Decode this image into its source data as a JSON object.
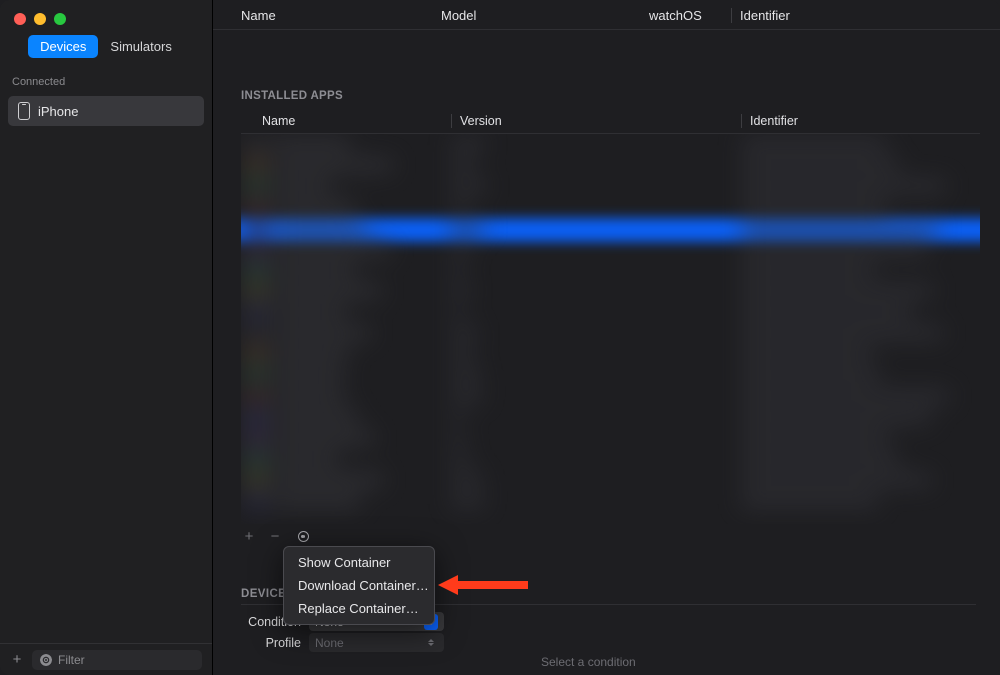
{
  "sidebar": {
    "tabs": {
      "devices": "Devices",
      "simulators": "Simulators"
    },
    "connected_label": "Connected",
    "device_name": "iPhone",
    "filter_placeholder": "Filter"
  },
  "watches_header": {
    "name": "Name",
    "model": "Model",
    "watchos": "watchOS",
    "identifier": "Identifier"
  },
  "installed_apps": {
    "label": "INSTALLED APPS",
    "columns": {
      "name": "Name",
      "version": "Version",
      "identifier": "Identifier"
    }
  },
  "context_menu": {
    "show": "Show Container",
    "download": "Download Container…",
    "replace": "Replace Container…"
  },
  "device_block": {
    "title": "DEVICE CONDITIONS",
    "condition_label": "Condition",
    "condition_value": "None",
    "profile_label": "Profile",
    "profile_value": "None",
    "hint": "Select a condition"
  }
}
